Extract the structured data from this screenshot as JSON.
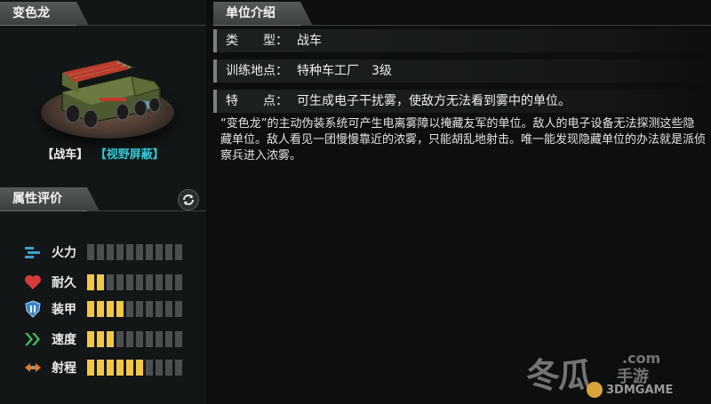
{
  "unit": {
    "name": "变色龙",
    "type_tag": "【战车】",
    "skill_tag": "【视野屏蔽】"
  },
  "attributes": {
    "title": "属性评价",
    "max_level": 10,
    "items": [
      {
        "label": "火力",
        "icon": "firepower-icon",
        "value": 0
      },
      {
        "label": "耐久",
        "icon": "heart-icon",
        "value": 2
      },
      {
        "label": "装甲",
        "icon": "armor-shield-icon",
        "value": 4
      },
      {
        "label": "速度",
        "icon": "speed-chevron-icon",
        "value": 3
      },
      {
        "label": "射程",
        "icon": "range-arrows-icon",
        "value": 6
      }
    ]
  },
  "info": {
    "title": "单位介绍",
    "type_key": "类　　型：",
    "type_value": "战车",
    "location_key": "训练地点：",
    "location_value": "特种车工厂　3级",
    "feature_key": "特　　点：",
    "feature_value": "可生成电子干扰雾，使敌方无法看到雾中的单位。",
    "description": "“变色龙”的主动伪装系统可产生电离雾障以掩藏友军的单位。敌人的电子设备无法探测这些隐藏单位。敌人看见一团慢慢靠近的浓雾，只能胡乱地射击。唯一能发现隐藏单位的办法就是派侦察兵进入浓雾。"
  },
  "watermark": {
    "brand": "冬瓜",
    "domain": ".com",
    "sub": "手游",
    "site": "3DMGAME"
  },
  "colors": {
    "bar_on": "#f2c746",
    "bar_off": "#4b4f4e",
    "skill_tag": "#35c8d8",
    "background": "#0d0f0f"
  }
}
